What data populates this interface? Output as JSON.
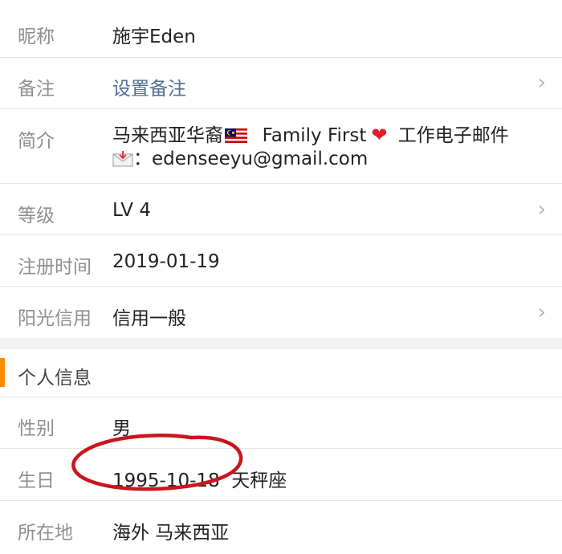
{
  "rows": [
    {
      "label": "昵称",
      "value": "施宇Eden"
    },
    {
      "label": "备注",
      "value": "设置备注"
    },
    {
      "label": "简介"
    },
    {
      "label": "等级",
      "value": "LV 4"
    },
    {
      "label": "注册时间",
      "value": "2019-01-19"
    },
    {
      "label": "阳光信用",
      "value": "信用一般"
    }
  ],
  "bio": {
    "part1": "马来西亚华裔",
    "part2": "Family First",
    "part3": "工作电子邮件",
    "part4": "：edenseeyu@gmail.com"
  },
  "section": {
    "title": "个人信息"
  },
  "personal": [
    {
      "label": "性别",
      "value": "男"
    },
    {
      "label": "生日",
      "value": "1995-10-18  天秤座"
    },
    {
      "label": "所在地",
      "value": "海外 马来西亚"
    }
  ],
  "icons": {
    "chevron": "chevron-right-icon",
    "flag": "malaysia-flag-icon",
    "heart": "red-heart-icon",
    "mail": "incoming-envelope-icon"
  },
  "colors": {
    "accent": "#ff8a00",
    "link": "#4f6d92",
    "annotation": "#c8161d"
  }
}
